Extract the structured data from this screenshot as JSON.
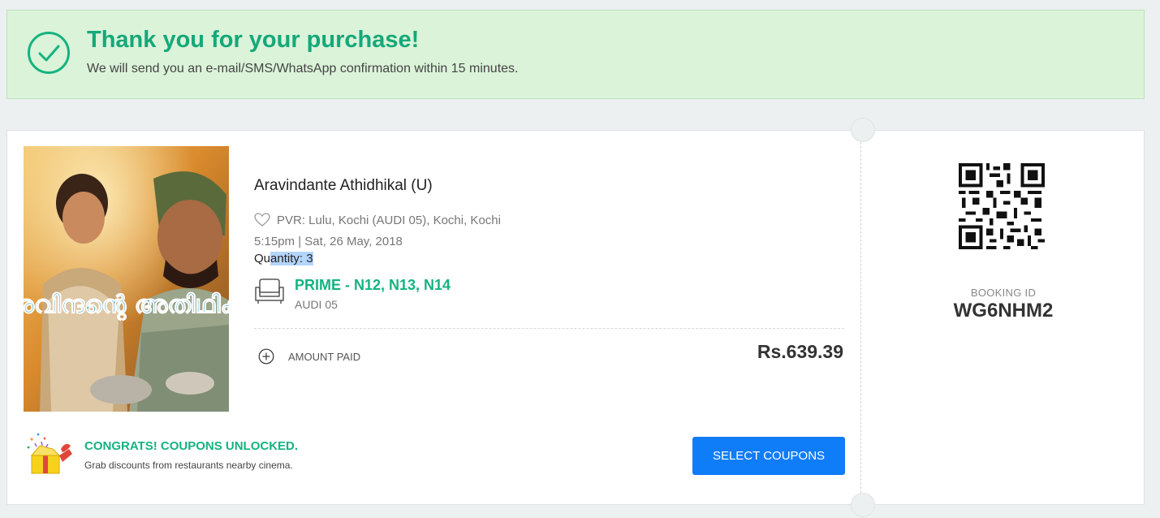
{
  "banner": {
    "title": "Thank you for your purchase!",
    "subtitle": "We will send you an e-mail/SMS/WhatsApp confirmation within 15 minutes.",
    "icon": "check-circle-icon",
    "accent_color": "#14a87a"
  },
  "booking": {
    "movie_title": "Aravindante Athidhikal (U)",
    "venue": "PVR: Lulu, Kochi (AUDI 05), Kochi, Kochi",
    "datetime": "5:15pm | Sat, 26 May, 2018",
    "quantity_prefix": "Qu",
    "quantity_selected": "antity: 3",
    "seats": "PRIME - N12, N13, N14",
    "audi": "AUDI 05",
    "amount_label": "AMOUNT PAID",
    "amount_value": "Rs.639.39"
  },
  "coupons": {
    "title": "CONGRATS! COUPONS UNLOCKED.",
    "subtitle": "Grab discounts from restaurants nearby cinema.",
    "button_label": "SELECT COUPONS",
    "button_color": "#0f7cf8"
  },
  "ticket_side": {
    "booking_label": "BOOKING ID",
    "booking_id": "WG6NHM2"
  },
  "poster": {
    "title_text": "അരവിന്ദന്റെ അതിഥികൾ"
  }
}
